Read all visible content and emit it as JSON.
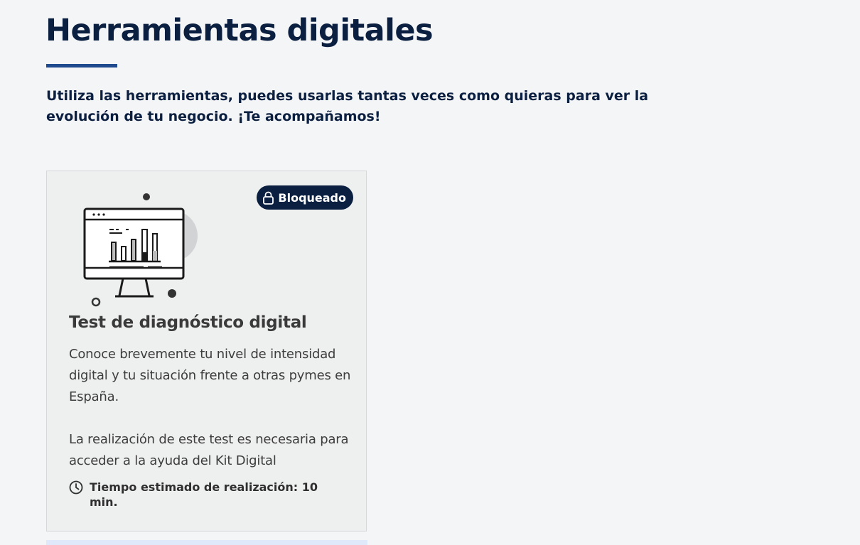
{
  "header": {
    "title": "Herramientas digitales",
    "intro": "Utiliza las herramientas, puedes usarlas tantas veces como quieras para ver la evolución de tu negocio. ¡Te acompañamos!"
  },
  "cards": [
    {
      "status_label": "Bloqueado",
      "status_icon": "lock-icon",
      "illustration_icon": "monitor-chart-icon",
      "title": "Test de diagnóstico digital",
      "description": "Conoce brevemente tu nivel de intensidad digital y tu situación frente a otras pymes en España.",
      "note": "La realización de este test es necesaria para acceder a la ayuda del Kit Digital",
      "time_icon": "clock-icon",
      "time_label": "Tiempo estimado de realización: 10 min."
    }
  ],
  "colors": {
    "page_background": "#f4f5f7",
    "heading": "#0b1f40",
    "accent": "#1f4b8e",
    "card_background": "#eeefef",
    "badge_background": "#0b1f40",
    "next_card_background": "#e0e9f9"
  }
}
